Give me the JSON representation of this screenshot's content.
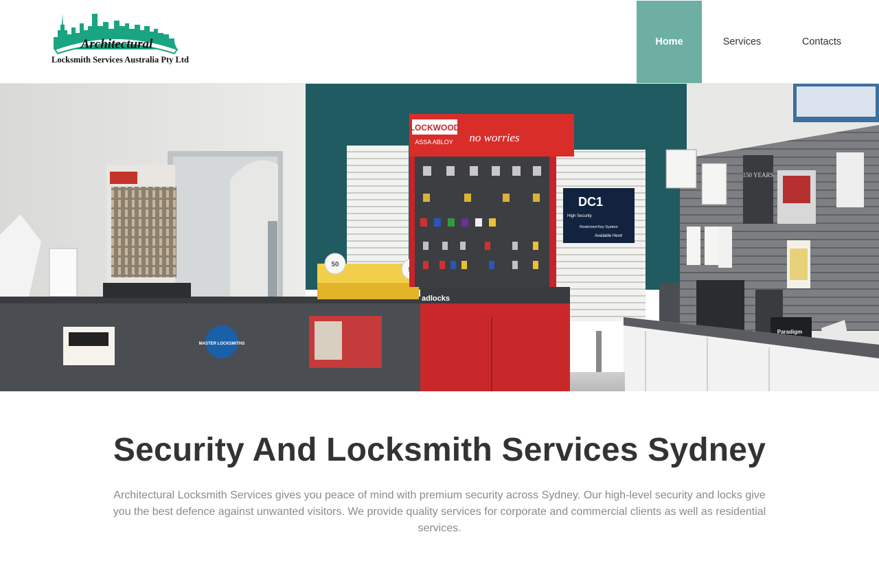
{
  "brand": {
    "logo_word": "Architectural",
    "logo_subtitle": "Locksmith Services Australia Pty Ltd",
    "accent_color": "#1aa582"
  },
  "nav": {
    "items": [
      {
        "label": "Home",
        "active": true
      },
      {
        "label": "Services",
        "active": false
      },
      {
        "label": "Contacts",
        "active": false
      }
    ],
    "active_color": "#6db0a3"
  },
  "hero": {
    "sign_brand": "LOCKWOOD",
    "sign_sub": "ASSA ABLOY",
    "sign_slogan": "no worries",
    "dc1_text": "DC1",
    "dc1_line1": "High Security",
    "dc1_line2": "Restricted Key System",
    "dc1_line3": "Available Here!",
    "badge_text": "50",
    "counter_label": "adlocks",
    "years_text": "150 YEARS",
    "paradigm_text": "Paradigm",
    "master_text": "MASTER LOCKSMITHS"
  },
  "content": {
    "headline": "Security And Locksmith Services Sydney",
    "intro": "Architectural Locksmith Services gives you peace of mind with premium security across Sydney. Our high-level security and locks give you the best defence against unwanted visitors. We provide quality services for corporate and commercial clients as well as residential services."
  }
}
